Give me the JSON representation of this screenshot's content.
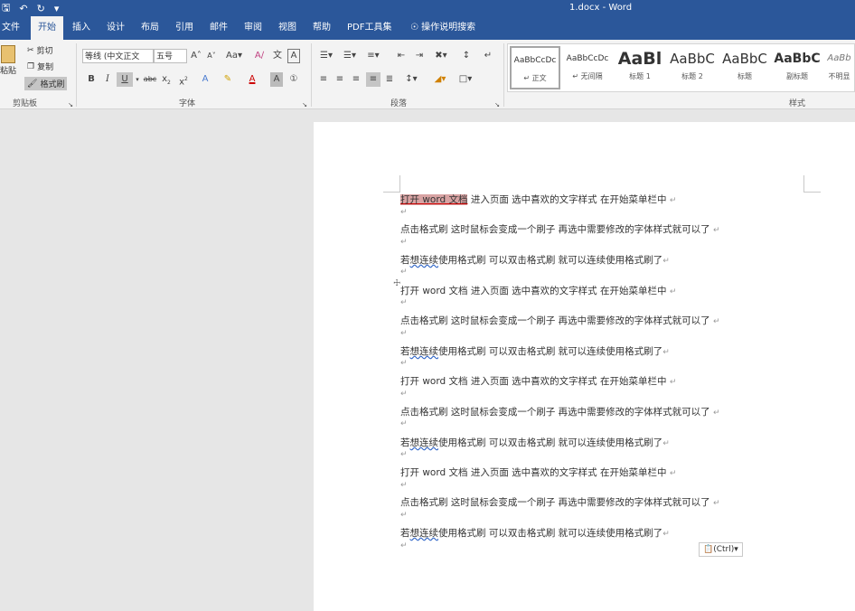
{
  "window": {
    "title": "1.docx  -  Word"
  },
  "tabs": [
    "文件",
    "开始",
    "插入",
    "设计",
    "布局",
    "引用",
    "邮件",
    "审阅",
    "视图",
    "帮助",
    "PDF工具集"
  ],
  "tell_me": "操作说明搜索",
  "clipboard": {
    "paste": "粘贴",
    "cut": "剪切",
    "copy": "复制",
    "format_painter": "格式刷",
    "label": "剪贴板"
  },
  "font": {
    "name": "等线 (中文正文",
    "size": "五号",
    "label": "字体"
  },
  "paragraph": {
    "label": "段落"
  },
  "styles": {
    "label": "样式",
    "items": [
      {
        "sample": "AaBbCcDc",
        "name": "↵ 正文"
      },
      {
        "sample": "AaBbCcDc",
        "name": "↵ 无间隔"
      },
      {
        "sample": "AaBl",
        "name": "标题 1"
      },
      {
        "sample": "AaBbC",
        "name": "标题 2"
      },
      {
        "sample": "AaBbC",
        "name": "标题"
      },
      {
        "sample": "AaBbC",
        "name": "副标题"
      },
      {
        "sample": "AaBb",
        "name": "不明显"
      }
    ]
  },
  "document": {
    "first_selected": "打开 word 文档",
    "line1_rest": "   进入页面    选中喜欢的文字样式    在开始菜单栏中  ",
    "line1_full": "打开 word 文档    进入页面    选中喜欢的文字样式    在开始菜单栏中  ",
    "line2": "点击格式刷    这时鼠标会变成一个刷子    再选中需要修改的字体样式就可以了  ",
    "line3_pre": "若",
    "line3_sq": "想连续",
    "line3_post": "使用格式刷    可以双击格式刷    就可以连续使用格式刷了",
    "para_mark": "↵"
  },
  "paste_options": "(Ctrl)"
}
